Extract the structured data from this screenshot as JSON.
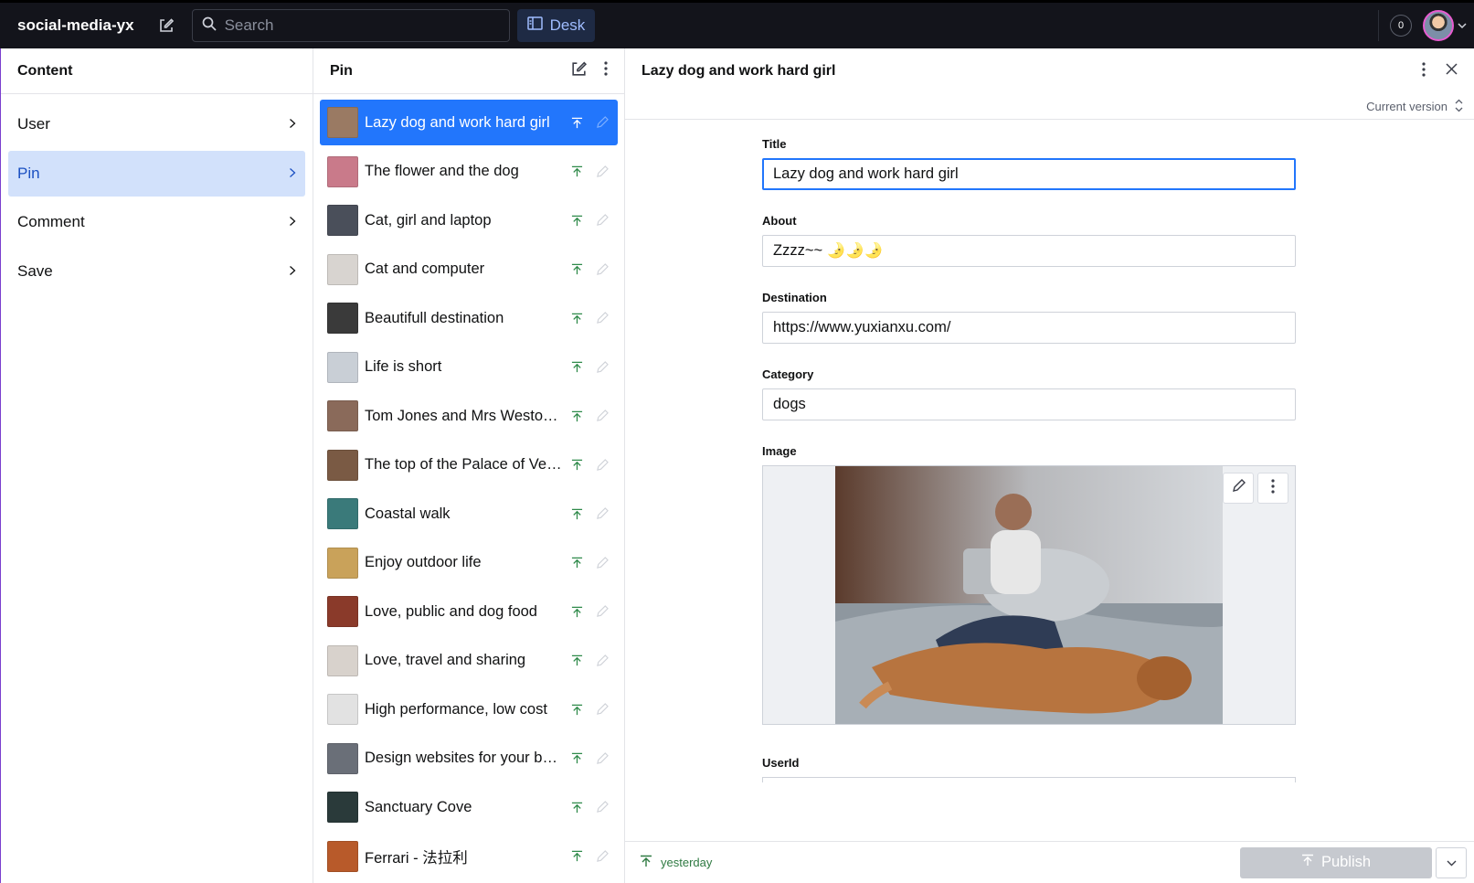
{
  "topbar": {
    "brand": "social-media-yx",
    "search_placeholder": "Search",
    "desk_label": "Desk",
    "notification_count": "0"
  },
  "content_pane": {
    "title": "Content",
    "items": [
      {
        "label": "User"
      },
      {
        "label": "Pin"
      },
      {
        "label": "Comment"
      },
      {
        "label": "Save"
      }
    ]
  },
  "pin_pane": {
    "title": "Pin",
    "items": [
      {
        "title": "Lazy dog and work hard girl",
        "thumb": "#9a7a63"
      },
      {
        "title": "The flower and the dog",
        "thumb": "#c97a8a"
      },
      {
        "title": "Cat, girl and laptop",
        "thumb": "#4a4f5a"
      },
      {
        "title": "Cat and computer",
        "thumb": "#d8d4d0"
      },
      {
        "title": "Beautifull destination",
        "thumb": "#3a3a3a"
      },
      {
        "title": "Life is short",
        "thumb": "#c9cfd6"
      },
      {
        "title": "Tom Jones and Mrs Weston ...",
        "thumb": "#8a6a5a"
      },
      {
        "title": "The top of the Palace of Vers...",
        "thumb": "#7a5a44"
      },
      {
        "title": "Coastal walk",
        "thumb": "#3a7a7a"
      },
      {
        "title": "Enjoy outdoor life",
        "thumb": "#c9a25a"
      },
      {
        "title": "Love, public and dog food",
        "thumb": "#8a3a2a"
      },
      {
        "title": "Love, travel and sharing",
        "thumb": "#d8d2cc"
      },
      {
        "title": "High performance, low cost",
        "thumb": "#e2e2e2"
      },
      {
        "title": "Design websites for your bus...",
        "thumb": "#6a6f78"
      },
      {
        "title": "Sanctuary Cove",
        "thumb": "#2a3a3a"
      },
      {
        "title": "Ferrari - 法拉利",
        "thumb": "#b85a2a"
      }
    ]
  },
  "document": {
    "title": "Lazy dog and work hard girl",
    "version_label": "Current version",
    "fields": {
      "title_label": "Title",
      "title_value": "Lazy dog and work hard girl",
      "about_label": "About",
      "about_value": "Zzzz~~ 🌛🌛🌛",
      "destination_label": "Destination",
      "destination_value": "https://www.yuxianxu.com/",
      "category_label": "Category",
      "category_value": "dogs",
      "image_label": "Image",
      "userid_label": "UserId"
    },
    "footer": {
      "status": "yesterday",
      "publish_label": "Publish"
    }
  },
  "colors": {
    "accent": "#2276fc",
    "topbar_bg": "#13141b",
    "nav_active_bg": "#d2e1fb",
    "published_green": "#2f7a42"
  }
}
